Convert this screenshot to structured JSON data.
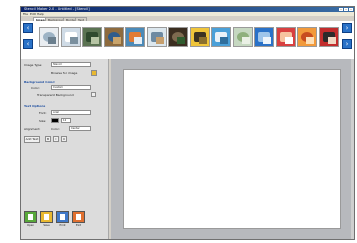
{
  "window": {
    "title": "Stencil Maker 2.0 - Untitled - [Stencil]",
    "controls": [
      "minimize",
      "maximize",
      "close"
    ]
  },
  "menu": [
    "File",
    "Edit",
    "Help"
  ],
  "tabs": [
    {
      "label": "Images",
      "active": true
    },
    {
      "label": "Backgrounds",
      "active": false
    },
    {
      "label": "Borders",
      "active": false
    },
    {
      "label": "Text",
      "active": false
    }
  ],
  "strip": {
    "left_arrow_icon": "left-arrow-icon",
    "right_arrow_icon": "right-arrow-icon",
    "thumbnails": [
      {
        "name": "bird",
        "colors": [
          "#e9edf1",
          "#9db3c5",
          "#6b7f8e"
        ]
      },
      {
        "name": "seagull",
        "colors": [
          "#cfdbe6",
          "#ffffff",
          "#7a8f9e"
        ]
      },
      {
        "name": "trees",
        "colors": [
          "#5b7352",
          "#2f4a2e",
          "#b7c5a5"
        ]
      },
      {
        "name": "mosaic",
        "colors": [
          "#8e6b3e",
          "#2f5c8c",
          "#c9a46b"
        ]
      },
      {
        "name": "fish",
        "colors": [
          "#4b8ab8",
          "#e07b35",
          "#e6eef5"
        ]
      },
      {
        "name": "crane",
        "colors": [
          "#dce7ee",
          "#6d8aa2",
          "#c69f6e"
        ]
      },
      {
        "name": "eagle",
        "colors": [
          "#3b2e20",
          "#7d6a4f",
          "#2f5b2e"
        ]
      },
      {
        "name": "yellow-bird",
        "colors": [
          "#f0c53a",
          "#3c3322",
          "#8a6f2e"
        ]
      },
      {
        "name": "landscape",
        "colors": [
          "#4aa0d8",
          "#e9f2f8",
          "#2f6e9c"
        ]
      },
      {
        "name": "pattern",
        "colors": [
          "#c6d8c1",
          "#8fb07d",
          "#eaf0e5"
        ]
      },
      {
        "name": "blue-circle",
        "colors": [
          "#2a72c8",
          "#9ec5ea",
          "#eef5fb"
        ]
      },
      {
        "name": "red-circle",
        "colors": [
          "#d84040",
          "#f6c3a0",
          "#ffffff"
        ]
      },
      {
        "name": "orange-floral",
        "colors": [
          "#f29a3b",
          "#c84d1f",
          "#fde0b8"
        ]
      },
      {
        "name": "figure",
        "colors": [
          "#c22d2d",
          "#2b2b2b",
          "#f1d8c4"
        ]
      }
    ]
  },
  "panel": {
    "image_label": "Image Type:",
    "image_value": "Stencil",
    "browse_label": "Browse for image",
    "section_background": "Background Color:",
    "color_label": "Color:",
    "color_value": "Custom",
    "transparent_label": "Transparent Background",
    "section_text": "Text Options",
    "font_label": "Font:",
    "font_value": "Arial",
    "size_label": "Size:",
    "size_value": "12",
    "text_color_label": "Color:",
    "align_label": "Alignment:",
    "align_value": "Center",
    "style_buttons": [
      "B",
      "I",
      "U"
    ],
    "add_text_label": "Add Text",
    "bottom_buttons": [
      {
        "label": "Open",
        "icon": "open-icon",
        "color": "#58a83a"
      },
      {
        "label": "Save",
        "icon": "save-icon",
        "color": "#e8b830"
      },
      {
        "label": "Print",
        "icon": "print-icon",
        "color": "#3f78c8"
      },
      {
        "label": "Exit",
        "icon": "exit-icon",
        "color": "#e07030"
      }
    ]
  },
  "colors": {
    "accent": "#2a72c8",
    "title_bar": "#0a246a",
    "canvas_bg": "#b7b9bd"
  }
}
